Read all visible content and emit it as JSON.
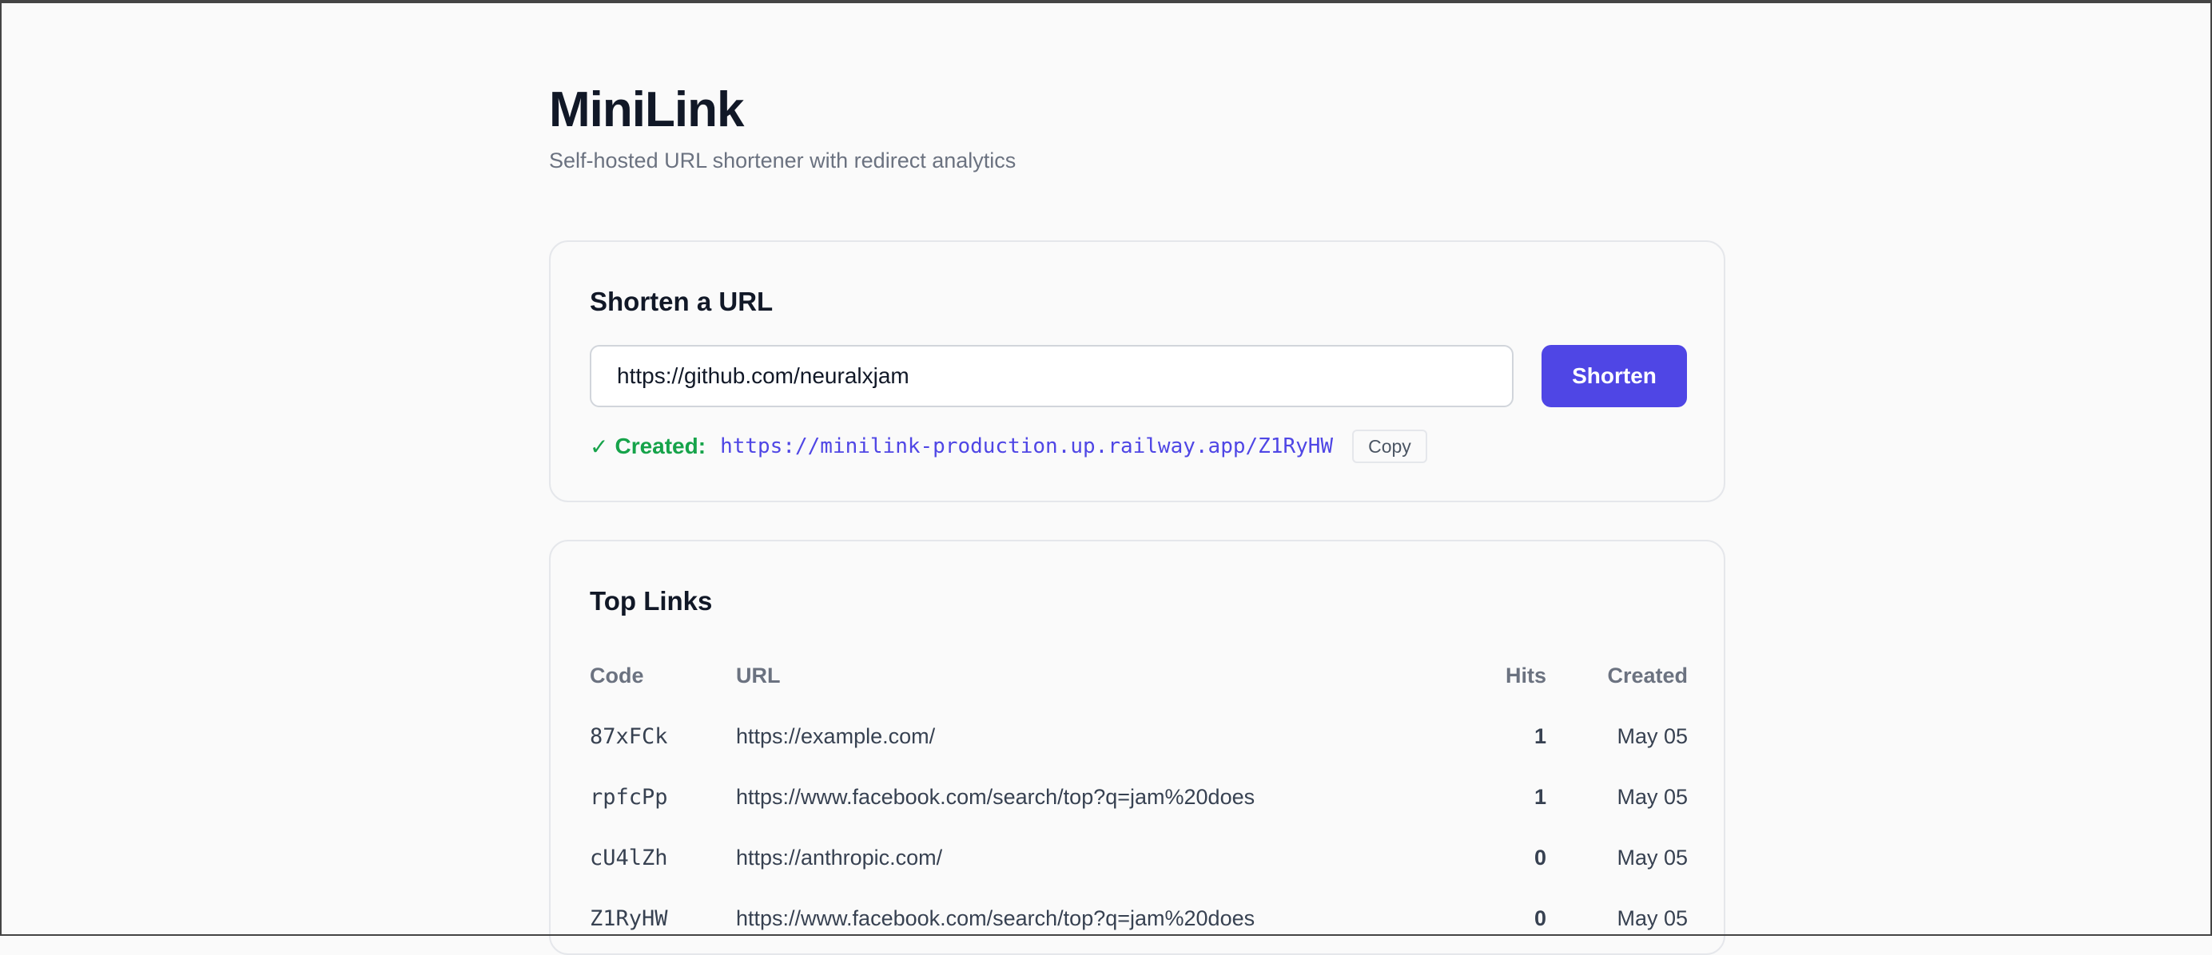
{
  "header": {
    "title": "MiniLink",
    "subtitle": "Self-hosted URL shortener with redirect analytics"
  },
  "shorten": {
    "title": "Shorten a URL",
    "input_value": "https://github.com/neuralxjam",
    "button_label": "Shorten",
    "result": {
      "check": "✓",
      "status_label": "Created:",
      "short_url": "https://minilink-production.up.railway.app/Z1RyHW",
      "copy_label": "Copy"
    }
  },
  "top_links": {
    "title": "Top Links",
    "columns": [
      "Code",
      "URL",
      "Hits",
      "Created"
    ],
    "rows": [
      {
        "code": "87xFCk",
        "url": "https://example.com/",
        "hits": "1",
        "created": "May 05"
      },
      {
        "code": "rpfcPp",
        "url": "https://www.facebook.com/search/top?q=jam%20does",
        "hits": "1",
        "created": "May 05"
      },
      {
        "code": "cU4lZh",
        "url": "https://anthropic.com/",
        "hits": "0",
        "created": "May 05"
      },
      {
        "code": "Z1RyHW",
        "url": "https://www.facebook.com/search/top?q=jam%20does",
        "hits": "0",
        "created": "May 05"
      }
    ]
  },
  "colors": {
    "accent": "#4f46e5",
    "success": "#16a34a",
    "muted": "#6b7280"
  }
}
